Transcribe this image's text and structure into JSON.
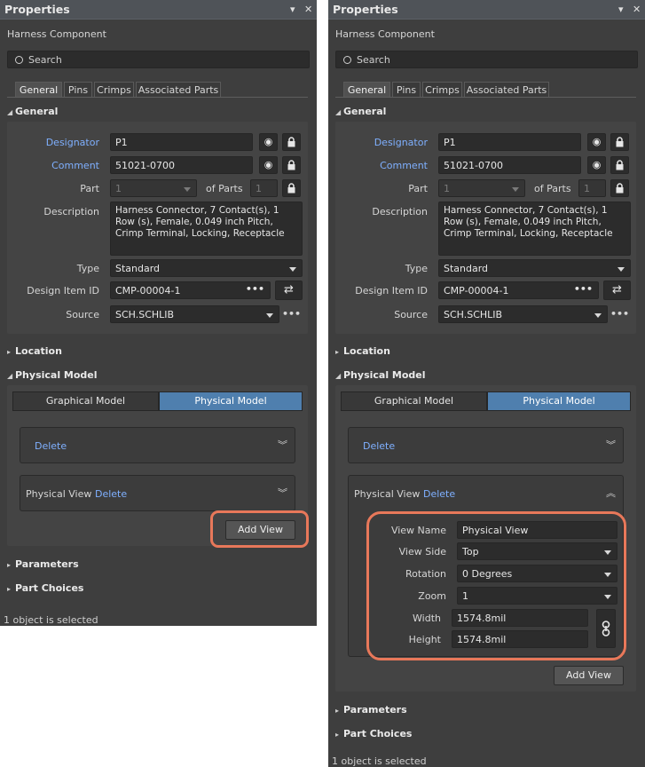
{
  "panel_title": "Properties",
  "subtitle": "Harness Component",
  "search_placeholder": "Search",
  "tabs": [
    "General",
    "Pins",
    "Crimps",
    "Associated Parts"
  ],
  "sections": {
    "general": "General",
    "location": "Location",
    "physical_model": "Physical Model",
    "parameters": "Parameters",
    "part_choices": "Part Choices"
  },
  "general": {
    "designator_label": "Designator",
    "designator_value": "P1",
    "comment_label": "Comment",
    "comment_value": "51021-0700",
    "part_label": "Part",
    "part_value": "1",
    "of_parts_label": "of Parts",
    "of_parts_value": "1",
    "description_label": "Description",
    "description_value": "Harness Connector, 7 Contact(s), 1 Row (s), Female, 0.049 inch Pitch, Crimp Terminal, Locking, Receptacle",
    "type_label": "Type",
    "type_value": "Standard",
    "design_item_label": "Design Item ID",
    "design_item_value": "CMP-00004-1",
    "source_label": "Source",
    "source_value": "SCH.SCHLIB",
    "more_label": "•••"
  },
  "physical_model": {
    "graphical_model_label": "Graphical Model",
    "physical_model_label": "Physical Model",
    "delete_label": "Delete",
    "physical_view_label": "Physical View",
    "add_view_label": "Add View"
  },
  "view": {
    "view_name_label": "View Name",
    "view_name_value": "Physical View",
    "view_side_label": "View Side",
    "view_side_value": "Top",
    "rotation_label": "Rotation",
    "rotation_value": "0 Degrees",
    "zoom_label": "Zoom",
    "zoom_value": "1",
    "width_label": "Width",
    "width_value": "1574.8mil",
    "height_label": "Height",
    "height_value": "1574.8mil"
  },
  "status_text": "1 object is selected",
  "colors": {
    "panel_bg": "#3e3e3e",
    "title_bg": "#4f5358",
    "link": "#7fb0ff",
    "toggle_active": "#4f7fae",
    "highlight": "#e8785a"
  }
}
